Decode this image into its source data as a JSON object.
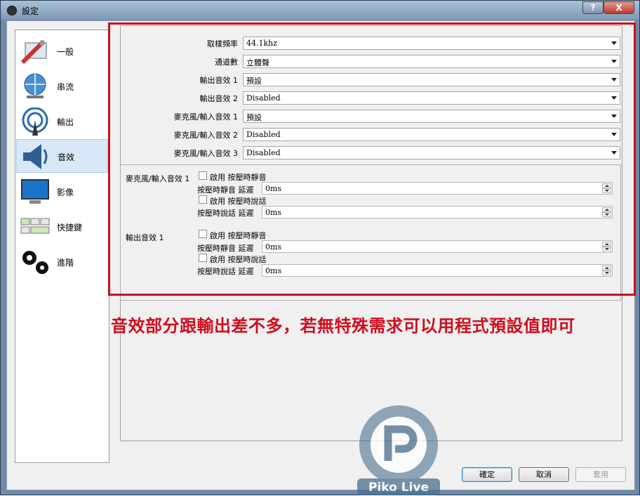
{
  "window": {
    "title": "設定",
    "help": "?",
    "close": "X"
  },
  "sidebar": {
    "items": [
      {
        "label": "一般",
        "icon": "general-icon"
      },
      {
        "label": "串流",
        "icon": "stream-globe-icon"
      },
      {
        "label": "輸出",
        "icon": "output-antenna-icon"
      },
      {
        "label": "音效",
        "icon": "speaker-icon"
      },
      {
        "label": "影像",
        "icon": "monitor-icon"
      },
      {
        "label": "快捷鍵",
        "icon": "keyboard-icon"
      },
      {
        "label": "進階",
        "icon": "gears-icon"
      }
    ],
    "active": 3
  },
  "audio": {
    "rows": [
      {
        "label": "取樣頻率",
        "value": "44.1khz"
      },
      {
        "label": "通道數",
        "value": "立體聲"
      },
      {
        "label": "輸出音效 1",
        "value": "預設"
      },
      {
        "label": "輸出音效 2",
        "value": "Disabled"
      },
      {
        "label": "麥克風/輸入音效 1",
        "value": "預設"
      },
      {
        "label": "麥克風/輸入音效 2",
        "value": "Disabled"
      },
      {
        "label": "麥克風/輸入音效 3",
        "value": "Disabled"
      }
    ],
    "groups": [
      {
        "title": "麥克風/輸入音效 1",
        "mute_cb": "啟用 按壓時靜音",
        "mute_delay_label": "按壓時靜音 延遲",
        "mute_delay": "0ms",
        "talk_cb": "啟用 按壓時說話",
        "talk_delay_label": "按壓時說話 延遲",
        "talk_delay": "0ms"
      },
      {
        "title": "輸出音效 1",
        "mute_cb": "啟用 按壓時靜音",
        "mute_delay_label": "按壓時靜音 延遲",
        "mute_delay": "0ms",
        "talk_cb": "啟用 按壓時說話",
        "talk_delay_label": "按壓時說話 延遲",
        "talk_delay": "0ms"
      }
    ]
  },
  "annotation": "音效部分跟輸出差不多，若無特殊需求可以用程式預設值即可",
  "buttons": {
    "ok": "確定",
    "cancel": "取消",
    "apply": "套用"
  },
  "watermark": {
    "brand": "Piko Live"
  },
  "colors": {
    "accent_red": "#c8101a",
    "title_bar": "#8fa8c2"
  }
}
